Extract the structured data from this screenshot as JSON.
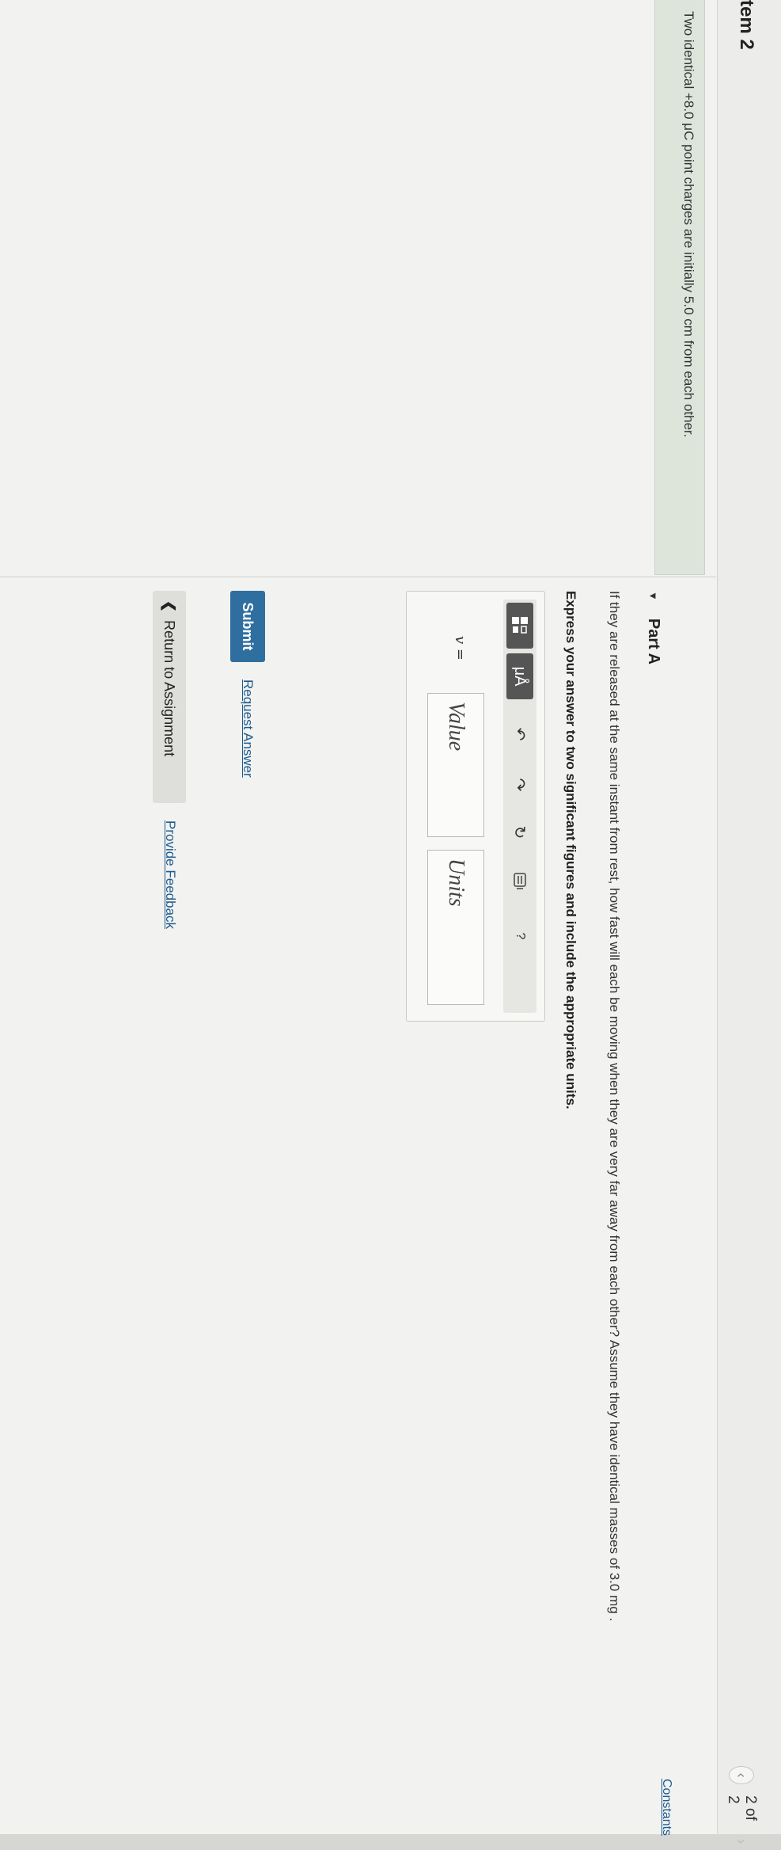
{
  "header": {
    "item_title": "tem 2",
    "pager_text": "2 of 2",
    "prev_icon": "chevron-left-icon",
    "next_icon": "chevron-right-icon",
    "constants_link": "Constants"
  },
  "problem": {
    "text": "Two identical +8.0 μC point charges are initially 5.0 cm from each other."
  },
  "part": {
    "title": "Part A",
    "question": "If they are released at the same instant from rest, how fast will each be moving when they are very far away from each other? Assume they have identical masses of 3.0 mg .",
    "instruction": "Express your answer to two significant figures and include the appropriate units."
  },
  "answer": {
    "variable_label": "v =",
    "value_placeholder": "Value",
    "units_placeholder": "Units",
    "toolbar": [
      {
        "icon": "templates-icon"
      },
      {
        "icon": "units-icon",
        "text": "μÅ"
      },
      {
        "icon": "undo-icon"
      },
      {
        "icon": "redo-icon"
      },
      {
        "icon": "reset-icon"
      },
      {
        "icon": "keyboard-icon"
      },
      {
        "icon": "help-icon",
        "text": "?"
      }
    ]
  },
  "actions": {
    "submit": "Submit",
    "request_answer": "Request Answer",
    "return": "Return to Assignment",
    "return_icon": "chevron-left-icon",
    "feedback": "Provide Feedback"
  }
}
